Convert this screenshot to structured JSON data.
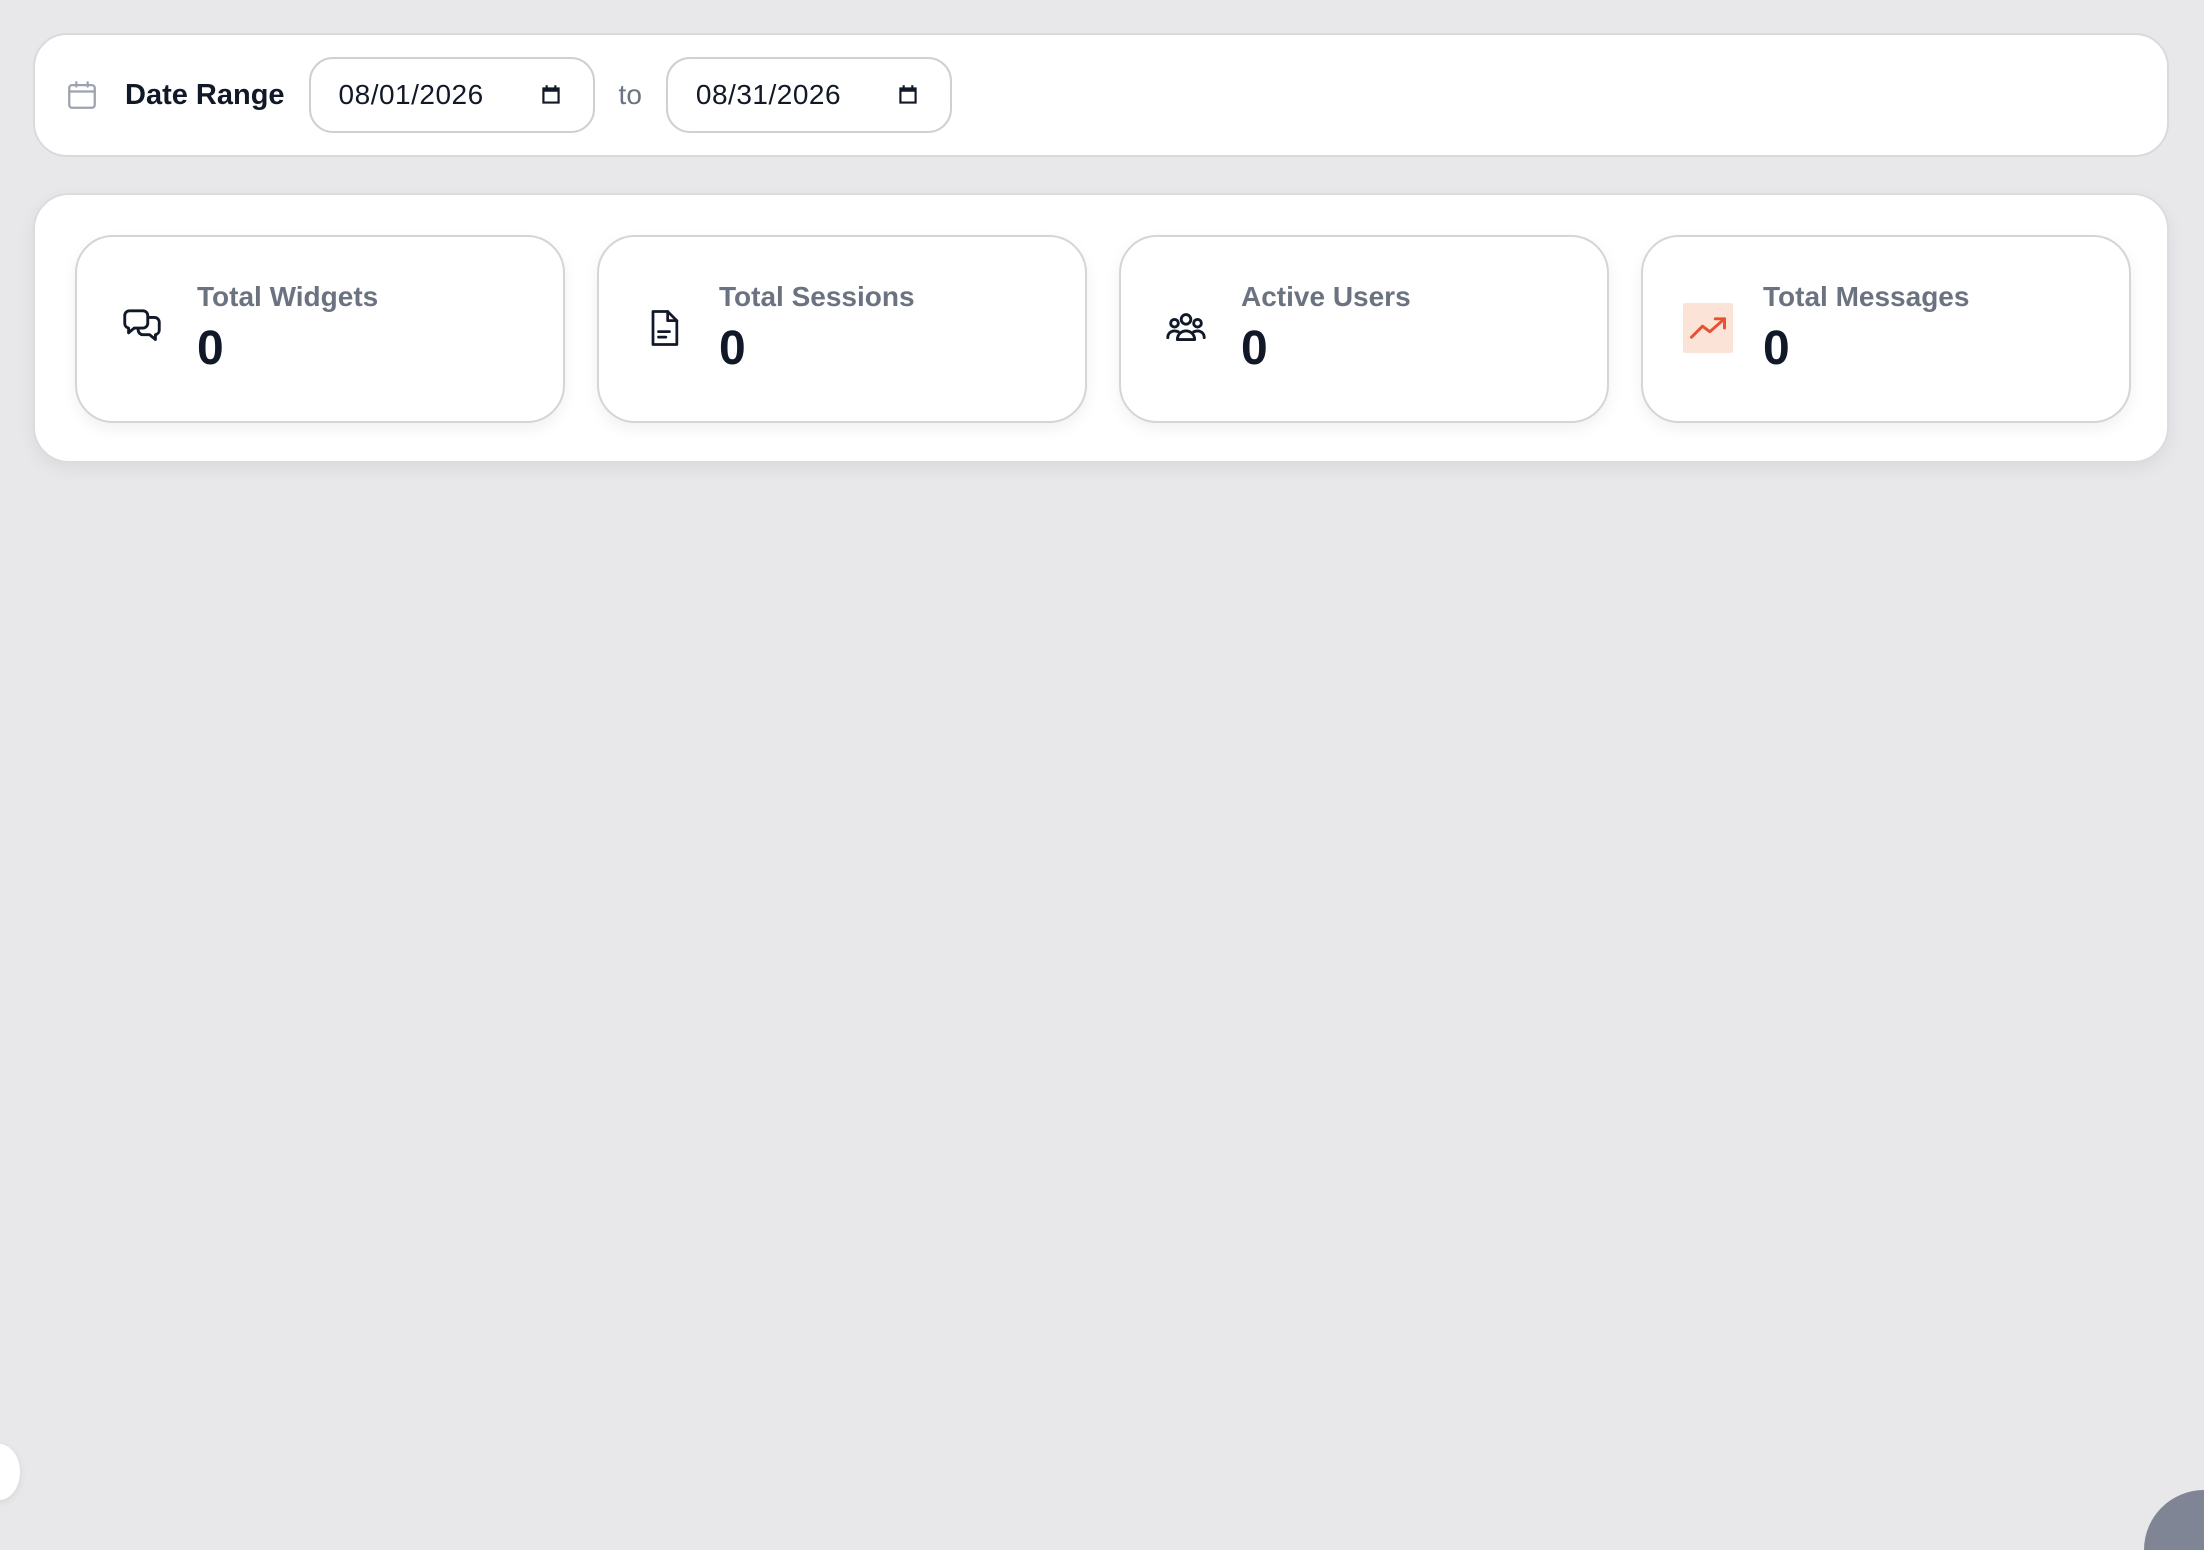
{
  "date_range": {
    "label": "Date Range",
    "start_date": "08/01/2026",
    "separator": "to",
    "end_date": "08/31/2026"
  },
  "stats": [
    {
      "label": "Total Widgets",
      "value": "0",
      "icon": "chat-bubbles-icon"
    },
    {
      "label": "Total Sessions",
      "value": "0",
      "icon": "document-icon"
    },
    {
      "label": "Active Users",
      "value": "0",
      "icon": "users-group-icon"
    },
    {
      "label": "Total Messages",
      "value": "0",
      "icon": "trending-up-icon"
    }
  ],
  "colors": {
    "background": "#e8e8eb",
    "panel": "#ffffff",
    "text_primary": "#111827",
    "text_muted": "#6b7280",
    "accent": "#e8502f",
    "accent_bg": "#fbe3d8"
  }
}
